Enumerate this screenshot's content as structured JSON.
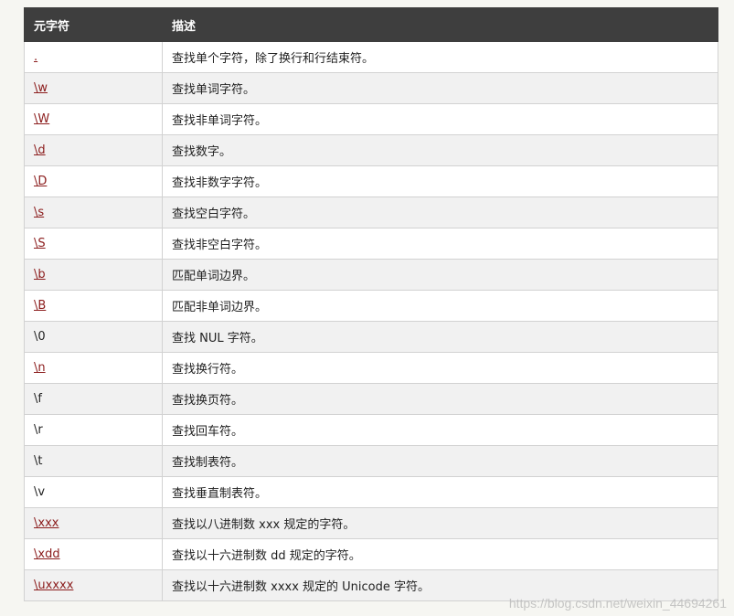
{
  "table": {
    "header": {
      "col1": "元字符",
      "col2": "描述"
    },
    "rows": [
      {
        "meta": ".",
        "desc": "查找单个字符，除了换行和行结束符。",
        "link": true
      },
      {
        "meta": "\\w",
        "desc": "查找单词字符。",
        "link": true
      },
      {
        "meta": "\\W",
        "desc": "查找非单词字符。",
        "link": true
      },
      {
        "meta": "\\d",
        "desc": "查找数字。",
        "link": true
      },
      {
        "meta": "\\D",
        "desc": "查找非数字字符。",
        "link": true
      },
      {
        "meta": "\\s",
        "desc": "查找空白字符。",
        "link": true
      },
      {
        "meta": "\\S",
        "desc": "查找非空白字符。",
        "link": true
      },
      {
        "meta": "\\b",
        "desc": "匹配单词边界。",
        "link": true
      },
      {
        "meta": "\\B",
        "desc": "匹配非单词边界。",
        "link": true
      },
      {
        "meta": "\\0",
        "desc": "查找 NUL 字符。",
        "link": false
      },
      {
        "meta": "\\n",
        "desc": "查找换行符。",
        "link": true
      },
      {
        "meta": "\\f",
        "desc": "查找换页符。",
        "link": false
      },
      {
        "meta": "\\r",
        "desc": "查找回车符。",
        "link": false
      },
      {
        "meta": "\\t",
        "desc": "查找制表符。",
        "link": false
      },
      {
        "meta": "\\v",
        "desc": "查找垂直制表符。",
        "link": false
      },
      {
        "meta": "\\xxx",
        "desc": "查找以八进制数 xxx 规定的字符。",
        "link": true
      },
      {
        "meta": "\\xdd",
        "desc": "查找以十六进制数 dd 规定的字符。",
        "link": true
      },
      {
        "meta": "\\uxxxx",
        "desc": "查找以十六进制数 xxxx 规定的 Unicode 字符。",
        "link": true
      }
    ]
  },
  "watermark": "https://blog.csdn.net/weixin_44694261",
  "colors": {
    "header_bg": "#3e3e3e",
    "link": "#8b1c1c",
    "row_alt_bg": "#f1f1f1",
    "page_bg": "#f6f6f2"
  }
}
